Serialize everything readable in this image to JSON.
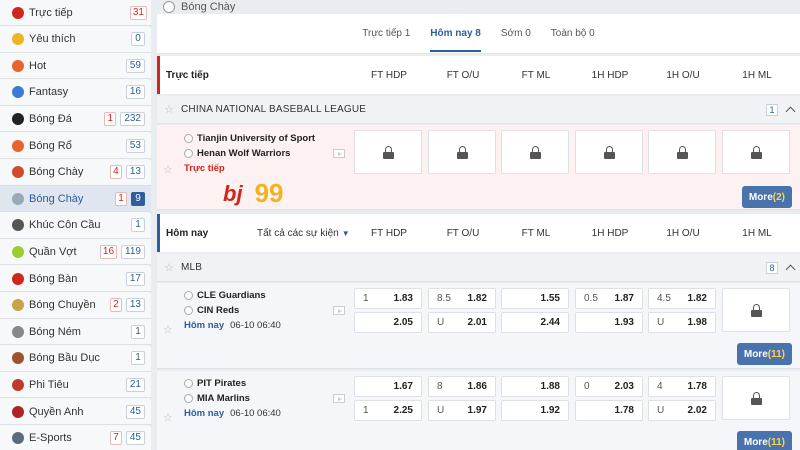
{
  "sidebar": {
    "items": [
      {
        "label": "Trực tiếp",
        "live": "",
        "count": "31",
        "icon": "live-icon",
        "color": "#d0261c",
        "countRed": true
      },
      {
        "label": "Yêu thích",
        "live": "",
        "count": "0",
        "icon": "star-icon",
        "color": "#f0b323"
      },
      {
        "label": "Hot",
        "live": "",
        "count": "59",
        "icon": "fire-icon",
        "color": "#e8642c"
      },
      {
        "label": "Fantasy",
        "live": "",
        "count": "16",
        "icon": "fantasy-icon",
        "color": "#3a7bd5"
      },
      {
        "label": "Bóng Đá",
        "live": "1",
        "count": "232",
        "icon": "soccer-icon",
        "color": "#222222"
      },
      {
        "label": "Bóng Rổ",
        "live": "",
        "count": "53",
        "icon": "basketball-icon",
        "color": "#e8642c"
      },
      {
        "label": "Bóng Chày",
        "live": "4",
        "count": "13",
        "icon": "baseball-icon",
        "color": "#d04a2c"
      },
      {
        "label": "Bóng Chày",
        "live": "1",
        "count": "9",
        "icon": "softball-icon",
        "color": "#9aa8b8",
        "active": true
      },
      {
        "label": "Khúc Côn Cầu",
        "live": "",
        "count": "1",
        "icon": "hockey-icon",
        "color": "#555555"
      },
      {
        "label": "Quần Vợt",
        "live": "16",
        "count": "119",
        "icon": "tennis-icon",
        "color": "#9acd32"
      },
      {
        "label": "Bóng Bàn",
        "live": "",
        "count": "17",
        "icon": "table-tennis-icon",
        "color": "#d0261c"
      },
      {
        "label": "Bóng Chuyền",
        "live": "2",
        "count": "13",
        "icon": "volleyball-icon",
        "color": "#c9a24a"
      },
      {
        "label": "Bóng Ném",
        "live": "",
        "count": "1",
        "icon": "handball-icon",
        "color": "#888888"
      },
      {
        "label": "Bóng Bầu Dục",
        "live": "",
        "count": "1",
        "icon": "rugby-icon",
        "color": "#a0522d"
      },
      {
        "label": "Phi Tiêu",
        "live": "",
        "count": "21",
        "icon": "darts-icon",
        "color": "#c0392b"
      },
      {
        "label": "Quyền Anh",
        "live": "",
        "count": "45",
        "icon": "boxing-icon",
        "color": "#b22222"
      },
      {
        "label": "E-Sports",
        "live": "7",
        "count": "45",
        "icon": "esports-icon",
        "color": "#5b6b7b"
      }
    ]
  },
  "header": {
    "title": "Bóng Chày",
    "tabs": [
      {
        "label": "Trực tiếp 1"
      },
      {
        "label": "Hôm nay 8",
        "active": true
      },
      {
        "label": "Sớm 0"
      },
      {
        "label": "Toàn bộ 0"
      }
    ]
  },
  "columns": [
    "FT HDP",
    "FT O/U",
    "FT ML",
    "1H HDP",
    "1H O/U",
    "1H ML"
  ],
  "live_section": {
    "title": "Trực tiếp",
    "league": {
      "name": "CHINA NATIONAL BASEBALL LEAGUE",
      "count": "1"
    },
    "match": {
      "home": "Tianjin University of Sport",
      "away": "Henan Wolf Warriors",
      "status": "Trực tiếp",
      "logo_text": "bj",
      "score_text": "99",
      "more_label": "More",
      "more_count": "(2)"
    }
  },
  "today_section": {
    "title": "Hôm nay",
    "filter": "Tất cả các sự kiện",
    "league": {
      "name": "MLB",
      "count": "8"
    },
    "matches": [
      {
        "home": "CLE Guardians",
        "away": "CIN Reds",
        "day": "Hôm nay",
        "time": "06-10 06:40",
        "more_label": "More",
        "more_count": "(11)",
        "top": {
          "hdp_line": "1",
          "hdp": "1.83",
          "ou_line": "8.5",
          "ou": "1.82",
          "ml": "1.55",
          "h1_hdp_line": "0.5",
          "h1_hdp": "1.87",
          "h1_ou_line": "4.5",
          "h1_ou": "1.82"
        },
        "bot": {
          "hdp_line": "",
          "hdp": "2.05",
          "ou_line": "U",
          "ou": "2.01",
          "ml": "2.44",
          "h1_hdp_line": "",
          "h1_hdp": "1.93",
          "h1_ou_line": "U",
          "h1_ou": "1.98"
        }
      },
      {
        "home": "PIT Pirates",
        "away": "MIA Marlins",
        "day": "Hôm nay",
        "time": "06-10 06:40",
        "more_label": "More",
        "more_count": "(11)",
        "top": {
          "hdp_line": "",
          "hdp": "1.67",
          "ou_line": "8",
          "ou": "1.86",
          "ml": "1.88",
          "h1_hdp_line": "0",
          "h1_hdp": "2.03",
          "h1_ou_line": "4",
          "h1_ou": "1.78"
        },
        "bot": {
          "hdp_line": "1",
          "hdp": "2.25",
          "ou_line": "U",
          "ou": "1.97",
          "ml": "1.92",
          "h1_hdp_line": "",
          "h1_hdp": "1.78",
          "h1_ou_line": "U",
          "h1_ou": "2.02"
        }
      }
    ]
  }
}
